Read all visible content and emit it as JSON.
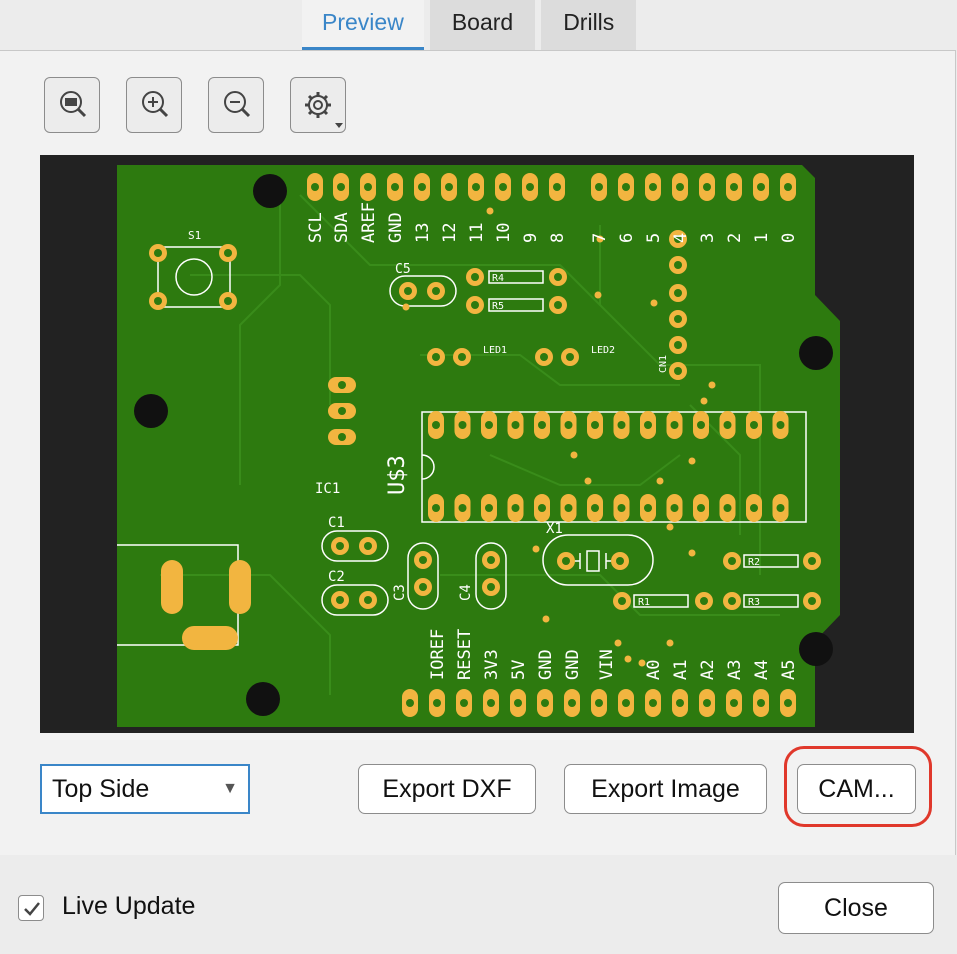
{
  "tabs": [
    {
      "label": "Preview",
      "active": true
    },
    {
      "label": "Board",
      "active": false
    },
    {
      "label": "Drills",
      "active": false
    }
  ],
  "toolbar": {
    "icons": [
      "zoom-fit-icon",
      "zoom-in-icon",
      "zoom-out-icon",
      "gear-icon"
    ]
  },
  "board": {
    "header_top_labels": [
      "SCL",
      "SDA",
      "AREF",
      "GND",
      "13",
      "12",
      "11",
      "10",
      "9",
      "8",
      "7",
      "6",
      "5",
      "4",
      "3",
      "2",
      "1",
      "0"
    ],
    "header_bottom_labels": [
      "IOREF",
      "RESET",
      "3V3",
      "5V",
      "GND",
      "GND",
      "VIN",
      "A0",
      "A1",
      "A2",
      "A3",
      "A4",
      "A5"
    ],
    "component_labels": [
      "S1",
      "C5",
      "R4",
      "R5",
      "LED1",
      "LED2",
      "CN1",
      "U$3",
      "IC1",
      "C1",
      "C2",
      "C3",
      "C4",
      "X1",
      "R2",
      "R1",
      "R3"
    ],
    "colors": {
      "substrate": "#2d7a0f",
      "copper": "#f2b540",
      "background": "#222222",
      "silkscreen": "#ffffff"
    }
  },
  "side_select": {
    "value": "Top Side"
  },
  "buttons": {
    "export_dxf": "Export DXF",
    "export_image": "Export Image",
    "cam": "CAM...",
    "close": "Close"
  },
  "live_update": {
    "label": "Live Update",
    "checked": true
  },
  "highlight": {
    "target": "cam-button",
    "color": "#e0382b"
  }
}
